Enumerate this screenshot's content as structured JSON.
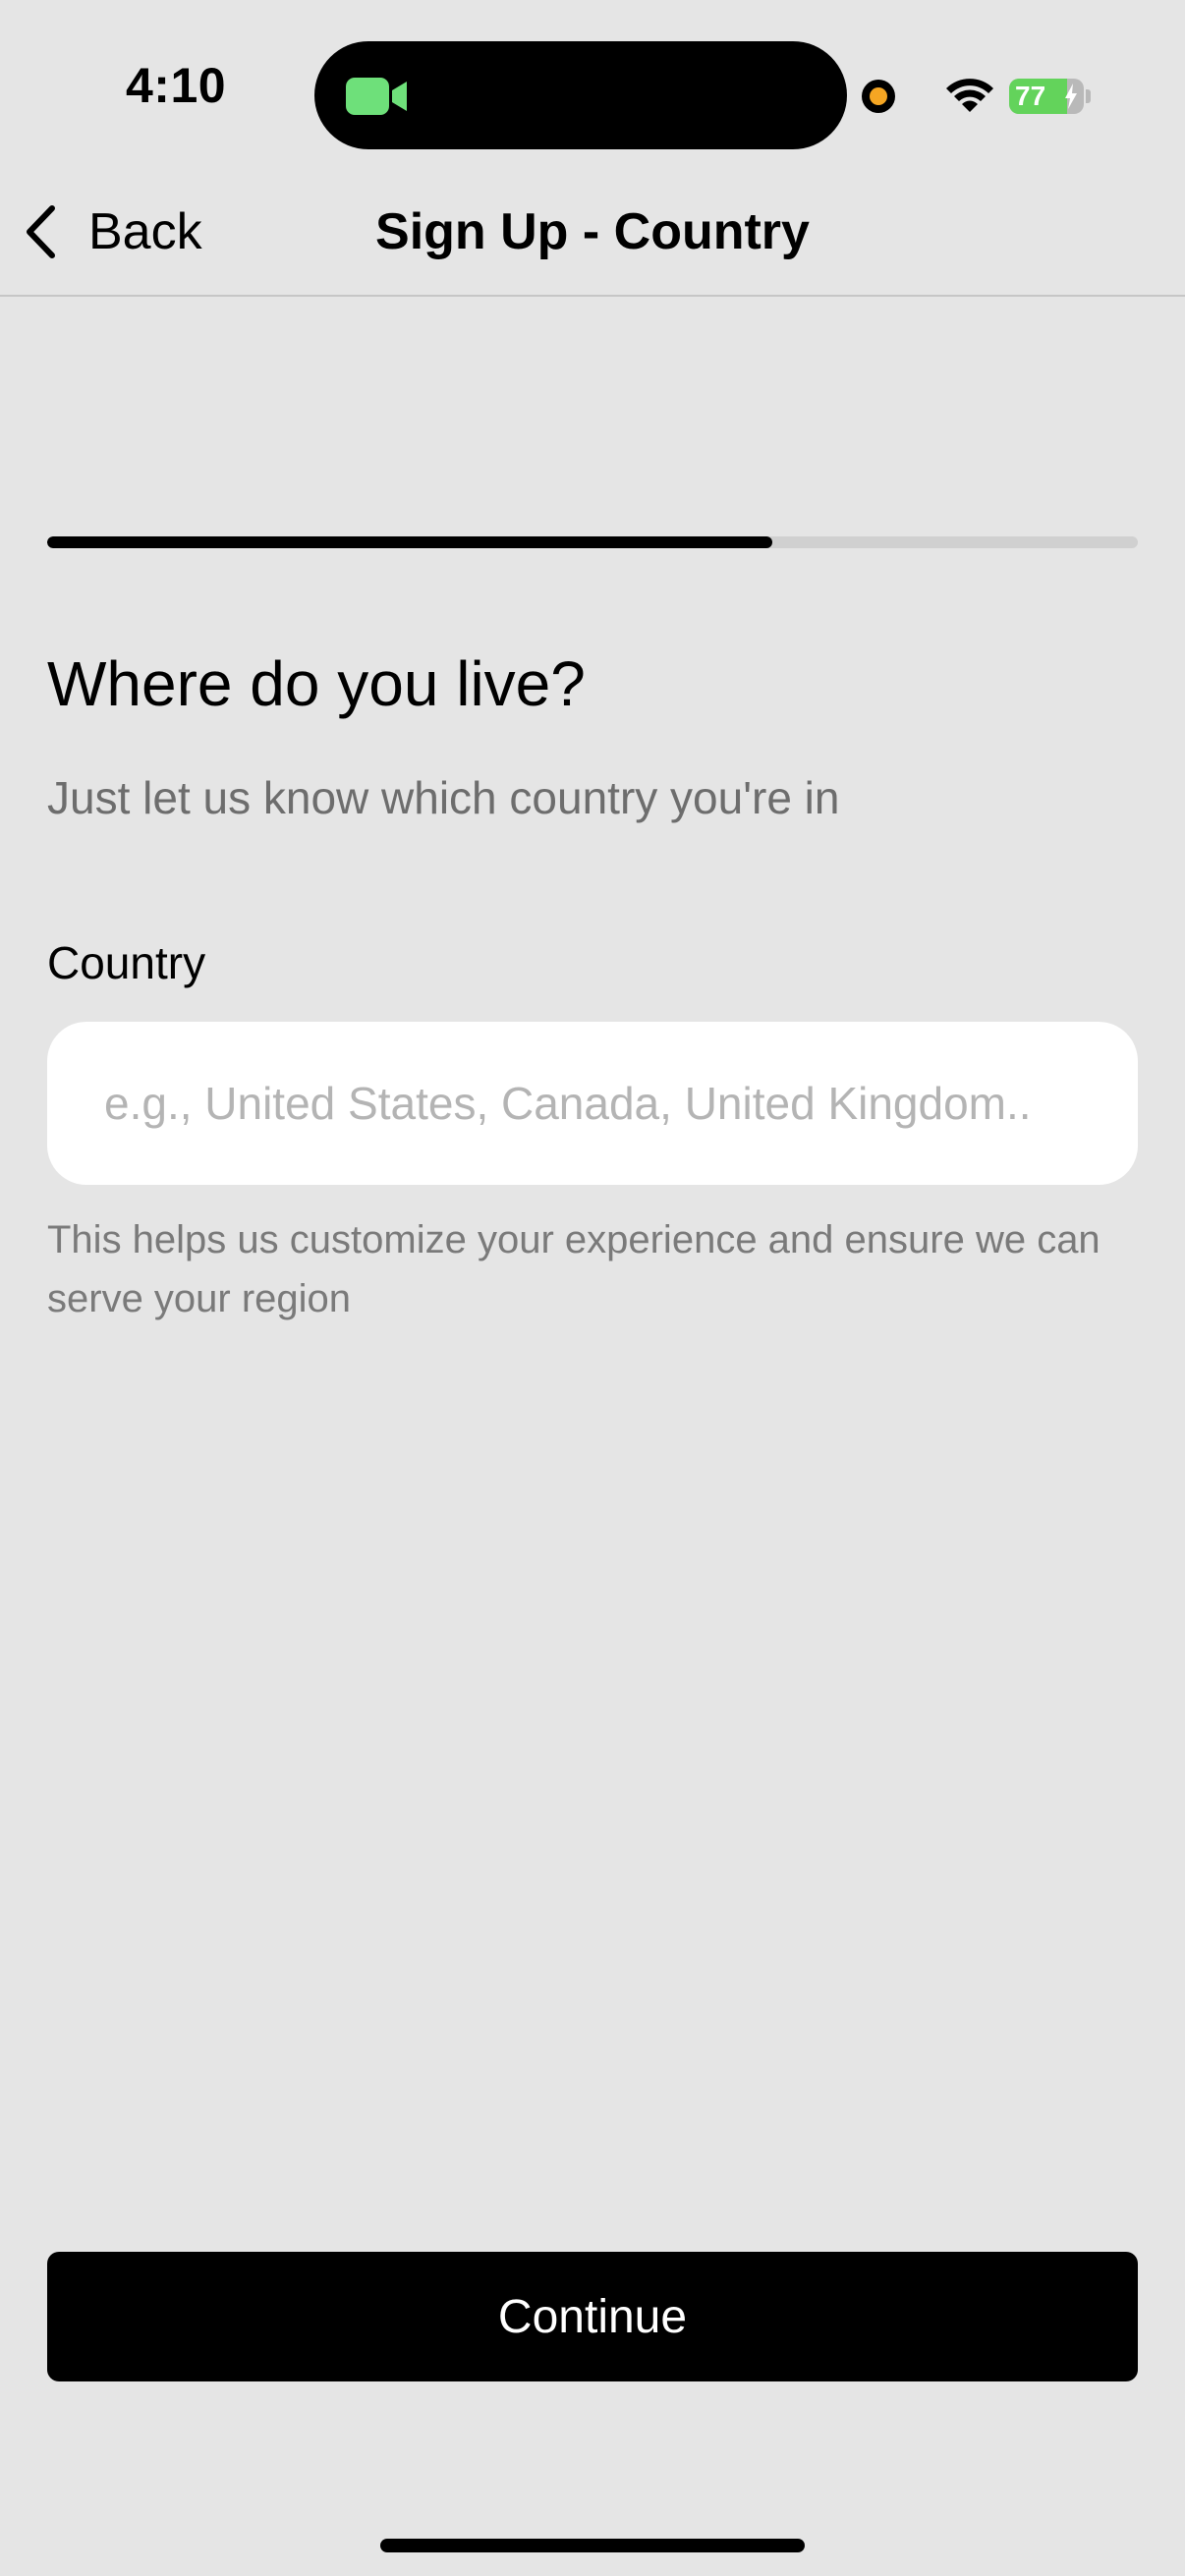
{
  "status_bar": {
    "time": "4:10",
    "battery_level": "77",
    "battery_percent": 77,
    "battery_charging": true,
    "icons": [
      "video-camera-icon",
      "privacy-indicator-dot",
      "wifi-icon",
      "battery-icon"
    ],
    "accent_colors": {
      "camera": "#6ee07a",
      "privacy_dot": "#f5a623",
      "battery": "#63d35b"
    }
  },
  "nav": {
    "back_label": "Back",
    "back_icon": "chevron-left-icon",
    "title": "Sign Up - Country"
  },
  "progress": {
    "fraction": 0.665
  },
  "content": {
    "heading": "Where do you live?",
    "subheading": "Just let us know which country you're in",
    "field_label": "Country",
    "input_value": "",
    "input_placeholder": "e.g., United States, Canada, United Kingdom..",
    "helper_text": "This helps us customize your experience and ensure we can serve your region"
  },
  "actions": {
    "continue_label": "Continue"
  }
}
